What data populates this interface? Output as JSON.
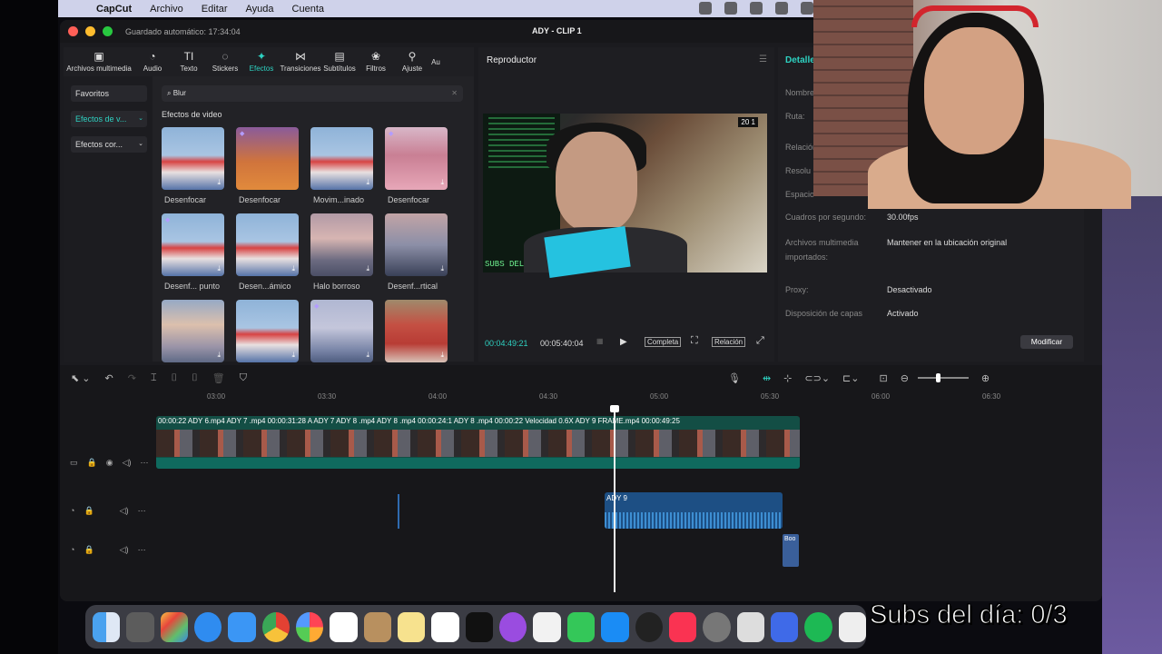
{
  "menubar": {
    "app": "CapCut",
    "items": [
      "Archivo",
      "Editar",
      "Ayuda",
      "Cuenta"
    ]
  },
  "window": {
    "saved": "Guardado automático: 17:34:04",
    "title": "ADY - CLIP 1"
  },
  "toolbar": [
    {
      "label": "Archivos multimedia",
      "icon": "▣"
    },
    {
      "label": "Audio",
      "icon": "◔"
    },
    {
      "label": "Texto",
      "icon": "TI"
    },
    {
      "label": "Stickers",
      "icon": "◌"
    },
    {
      "label": "Efectos",
      "icon": "✦"
    },
    {
      "label": "Transiciones",
      "icon": "⋈"
    },
    {
      "label": "Subtítulos",
      "icon": "▤"
    },
    {
      "label": "Filtros",
      "icon": "❀"
    },
    {
      "label": "Ajuste",
      "icon": "⚲"
    },
    {
      "label": "Au",
      "icon": ""
    }
  ],
  "side": {
    "favorites": "Favoritos",
    "video_effects": "Efectos de v...",
    "body_effects": "Efectos cor..."
  },
  "search": {
    "value": "Blur"
  },
  "section_title": "Efectos de video",
  "effects": [
    {
      "label": "Desenfocar"
    },
    {
      "label": "Desenfocar"
    },
    {
      "label": "Movim...inado"
    },
    {
      "label": "Desenfocar"
    },
    {
      "label": "Desenf... punto"
    },
    {
      "label": "Desen...ámico"
    },
    {
      "label": "Halo borroso"
    },
    {
      "label": "Desenf...rtical"
    },
    {
      "label": ""
    },
    {
      "label": ""
    },
    {
      "label": ""
    },
    {
      "label": ""
    }
  ],
  "player": {
    "title": "Reproductor",
    "current": "00:04:49:21",
    "total": "00:05:40:04",
    "full": "Completa",
    "ratio": "Relación",
    "hud": "20  1",
    "subs_text": "SUBS DEL"
  },
  "details": {
    "title": "Detalle",
    "rows": [
      {
        "label": "Nombre",
        "value": ""
      },
      {
        "label": "Ruta:",
        "value": ""
      },
      {
        "label": "Relación",
        "value": ""
      },
      {
        "label": "Resolu",
        "value": ""
      },
      {
        "label": "Espacio",
        "value": ""
      },
      {
        "label": "Cuadros por segundo:",
        "value": "30.00fps"
      },
      {
        "label": "Archivos multimedia importados:",
        "value": "Mantener en la ubicación original"
      },
      {
        "label": "Proxy:",
        "value": "Desactivado"
      },
      {
        "label": "Disposición de capas",
        "value": "Activado"
      }
    ],
    "modify": "Modificar"
  },
  "timeline": {
    "ruler": [
      "03:00",
      "03:30",
      "04:00",
      "04:30",
      "05:00",
      "05:30",
      "06:00",
      "06:30"
    ],
    "video_labels": "00:00:22  ADY 6.mp4  ADY 7 .mp4  00:00:31:28   A  ADY 7  ADY 8 .mp4  ADY 8 .mp4  00:00:24:1  ADY 8 .mp4  00:00:22  Velocidad 0.6X   ADY 9 FRAME.mp4  00:00:49:25",
    "audio_label": "ADY 9",
    "boom_label": "Boo"
  },
  "overlay": {
    "subs": "Subs del día: 0/3"
  },
  "colors": {
    "accent": "#2ed2c2",
    "track_video": "#134e45",
    "track_audio": "#1d4f84"
  }
}
